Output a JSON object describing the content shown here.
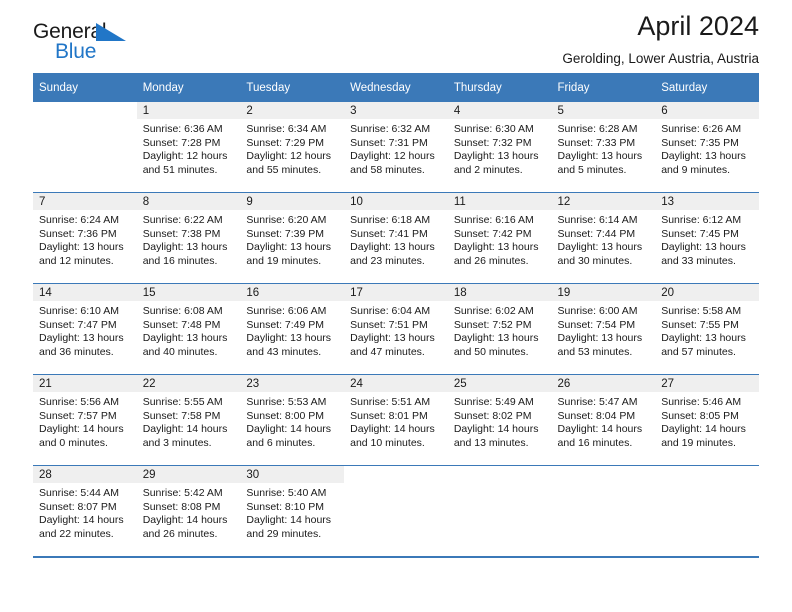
{
  "brand": {
    "word_one": "General",
    "word_two": "Blue",
    "triangle_color": "#2176c7",
    "text_color": "#1a1a1a"
  },
  "header": {
    "title": "April 2024",
    "location": "Gerolding, Lower Austria, Austria"
  },
  "theme": {
    "header_blue": "#3b79b8",
    "daynum_band": "#efefef",
    "rule_blue": "#3b79b8",
    "text": "#1a1a1a",
    "background": "#ffffff"
  },
  "weekday_headers": [
    "Sunday",
    "Monday",
    "Tuesday",
    "Wednesday",
    "Thursday",
    "Friday",
    "Saturday"
  ],
  "weeks": [
    [
      {
        "day": "",
        "sunrise": "",
        "sunset": "",
        "daylight_line1": "",
        "daylight_line2": "",
        "empty": true
      },
      {
        "day": "1",
        "sunrise": "Sunrise: 6:36 AM",
        "sunset": "Sunset: 7:28 PM",
        "daylight_line1": "Daylight: 12 hours",
        "daylight_line2": "and 51 minutes."
      },
      {
        "day": "2",
        "sunrise": "Sunrise: 6:34 AM",
        "sunset": "Sunset: 7:29 PM",
        "daylight_line1": "Daylight: 12 hours",
        "daylight_line2": "and 55 minutes."
      },
      {
        "day": "3",
        "sunrise": "Sunrise: 6:32 AM",
        "sunset": "Sunset: 7:31 PM",
        "daylight_line1": "Daylight: 12 hours",
        "daylight_line2": "and 58 minutes."
      },
      {
        "day": "4",
        "sunrise": "Sunrise: 6:30 AM",
        "sunset": "Sunset: 7:32 PM",
        "daylight_line1": "Daylight: 13 hours",
        "daylight_line2": "and 2 minutes."
      },
      {
        "day": "5",
        "sunrise": "Sunrise: 6:28 AM",
        "sunset": "Sunset: 7:33 PM",
        "daylight_line1": "Daylight: 13 hours",
        "daylight_line2": "and 5 minutes."
      },
      {
        "day": "6",
        "sunrise": "Sunrise: 6:26 AM",
        "sunset": "Sunset: 7:35 PM",
        "daylight_line1": "Daylight: 13 hours",
        "daylight_line2": "and 9 minutes."
      }
    ],
    [
      {
        "day": "7",
        "sunrise": "Sunrise: 6:24 AM",
        "sunset": "Sunset: 7:36 PM",
        "daylight_line1": "Daylight: 13 hours",
        "daylight_line2": "and 12 minutes."
      },
      {
        "day": "8",
        "sunrise": "Sunrise: 6:22 AM",
        "sunset": "Sunset: 7:38 PM",
        "daylight_line1": "Daylight: 13 hours",
        "daylight_line2": "and 16 minutes."
      },
      {
        "day": "9",
        "sunrise": "Sunrise: 6:20 AM",
        "sunset": "Sunset: 7:39 PM",
        "daylight_line1": "Daylight: 13 hours",
        "daylight_line2": "and 19 minutes."
      },
      {
        "day": "10",
        "sunrise": "Sunrise: 6:18 AM",
        "sunset": "Sunset: 7:41 PM",
        "daylight_line1": "Daylight: 13 hours",
        "daylight_line2": "and 23 minutes."
      },
      {
        "day": "11",
        "sunrise": "Sunrise: 6:16 AM",
        "sunset": "Sunset: 7:42 PM",
        "daylight_line1": "Daylight: 13 hours",
        "daylight_line2": "and 26 minutes."
      },
      {
        "day": "12",
        "sunrise": "Sunrise: 6:14 AM",
        "sunset": "Sunset: 7:44 PM",
        "daylight_line1": "Daylight: 13 hours",
        "daylight_line2": "and 30 minutes."
      },
      {
        "day": "13",
        "sunrise": "Sunrise: 6:12 AM",
        "sunset": "Sunset: 7:45 PM",
        "daylight_line1": "Daylight: 13 hours",
        "daylight_line2": "and 33 minutes."
      }
    ],
    [
      {
        "day": "14",
        "sunrise": "Sunrise: 6:10 AM",
        "sunset": "Sunset: 7:47 PM",
        "daylight_line1": "Daylight: 13 hours",
        "daylight_line2": "and 36 minutes."
      },
      {
        "day": "15",
        "sunrise": "Sunrise: 6:08 AM",
        "sunset": "Sunset: 7:48 PM",
        "daylight_line1": "Daylight: 13 hours",
        "daylight_line2": "and 40 minutes."
      },
      {
        "day": "16",
        "sunrise": "Sunrise: 6:06 AM",
        "sunset": "Sunset: 7:49 PM",
        "daylight_line1": "Daylight: 13 hours",
        "daylight_line2": "and 43 minutes."
      },
      {
        "day": "17",
        "sunrise": "Sunrise: 6:04 AM",
        "sunset": "Sunset: 7:51 PM",
        "daylight_line1": "Daylight: 13 hours",
        "daylight_line2": "and 47 minutes."
      },
      {
        "day": "18",
        "sunrise": "Sunrise: 6:02 AM",
        "sunset": "Sunset: 7:52 PM",
        "daylight_line1": "Daylight: 13 hours",
        "daylight_line2": "and 50 minutes."
      },
      {
        "day": "19",
        "sunrise": "Sunrise: 6:00 AM",
        "sunset": "Sunset: 7:54 PM",
        "daylight_line1": "Daylight: 13 hours",
        "daylight_line2": "and 53 minutes."
      },
      {
        "day": "20",
        "sunrise": "Sunrise: 5:58 AM",
        "sunset": "Sunset: 7:55 PM",
        "daylight_line1": "Daylight: 13 hours",
        "daylight_line2": "and 57 minutes."
      }
    ],
    [
      {
        "day": "21",
        "sunrise": "Sunrise: 5:56 AM",
        "sunset": "Sunset: 7:57 PM",
        "daylight_line1": "Daylight: 14 hours",
        "daylight_line2": "and 0 minutes."
      },
      {
        "day": "22",
        "sunrise": "Sunrise: 5:55 AM",
        "sunset": "Sunset: 7:58 PM",
        "daylight_line1": "Daylight: 14 hours",
        "daylight_line2": "and 3 minutes."
      },
      {
        "day": "23",
        "sunrise": "Sunrise: 5:53 AM",
        "sunset": "Sunset: 8:00 PM",
        "daylight_line1": "Daylight: 14 hours",
        "daylight_line2": "and 6 minutes."
      },
      {
        "day": "24",
        "sunrise": "Sunrise: 5:51 AM",
        "sunset": "Sunset: 8:01 PM",
        "daylight_line1": "Daylight: 14 hours",
        "daylight_line2": "and 10 minutes."
      },
      {
        "day": "25",
        "sunrise": "Sunrise: 5:49 AM",
        "sunset": "Sunset: 8:02 PM",
        "daylight_line1": "Daylight: 14 hours",
        "daylight_line2": "and 13 minutes."
      },
      {
        "day": "26",
        "sunrise": "Sunrise: 5:47 AM",
        "sunset": "Sunset: 8:04 PM",
        "daylight_line1": "Daylight: 14 hours",
        "daylight_line2": "and 16 minutes."
      },
      {
        "day": "27",
        "sunrise": "Sunrise: 5:46 AM",
        "sunset": "Sunset: 8:05 PM",
        "daylight_line1": "Daylight: 14 hours",
        "daylight_line2": "and 19 minutes."
      }
    ],
    [
      {
        "day": "28",
        "sunrise": "Sunrise: 5:44 AM",
        "sunset": "Sunset: 8:07 PM",
        "daylight_line1": "Daylight: 14 hours",
        "daylight_line2": "and 22 minutes."
      },
      {
        "day": "29",
        "sunrise": "Sunrise: 5:42 AM",
        "sunset": "Sunset: 8:08 PM",
        "daylight_line1": "Daylight: 14 hours",
        "daylight_line2": "and 26 minutes."
      },
      {
        "day": "30",
        "sunrise": "Sunrise: 5:40 AM",
        "sunset": "Sunset: 8:10 PM",
        "daylight_line1": "Daylight: 14 hours",
        "daylight_line2": "and 29 minutes."
      },
      {
        "day": "",
        "sunrise": "",
        "sunset": "",
        "daylight_line1": "",
        "daylight_line2": "",
        "empty": true
      },
      {
        "day": "",
        "sunrise": "",
        "sunset": "",
        "daylight_line1": "",
        "daylight_line2": "",
        "empty": true
      },
      {
        "day": "",
        "sunrise": "",
        "sunset": "",
        "daylight_line1": "",
        "daylight_line2": "",
        "empty": true
      },
      {
        "day": "",
        "sunrise": "",
        "sunset": "",
        "daylight_line1": "",
        "daylight_line2": "",
        "empty": true
      }
    ]
  ]
}
